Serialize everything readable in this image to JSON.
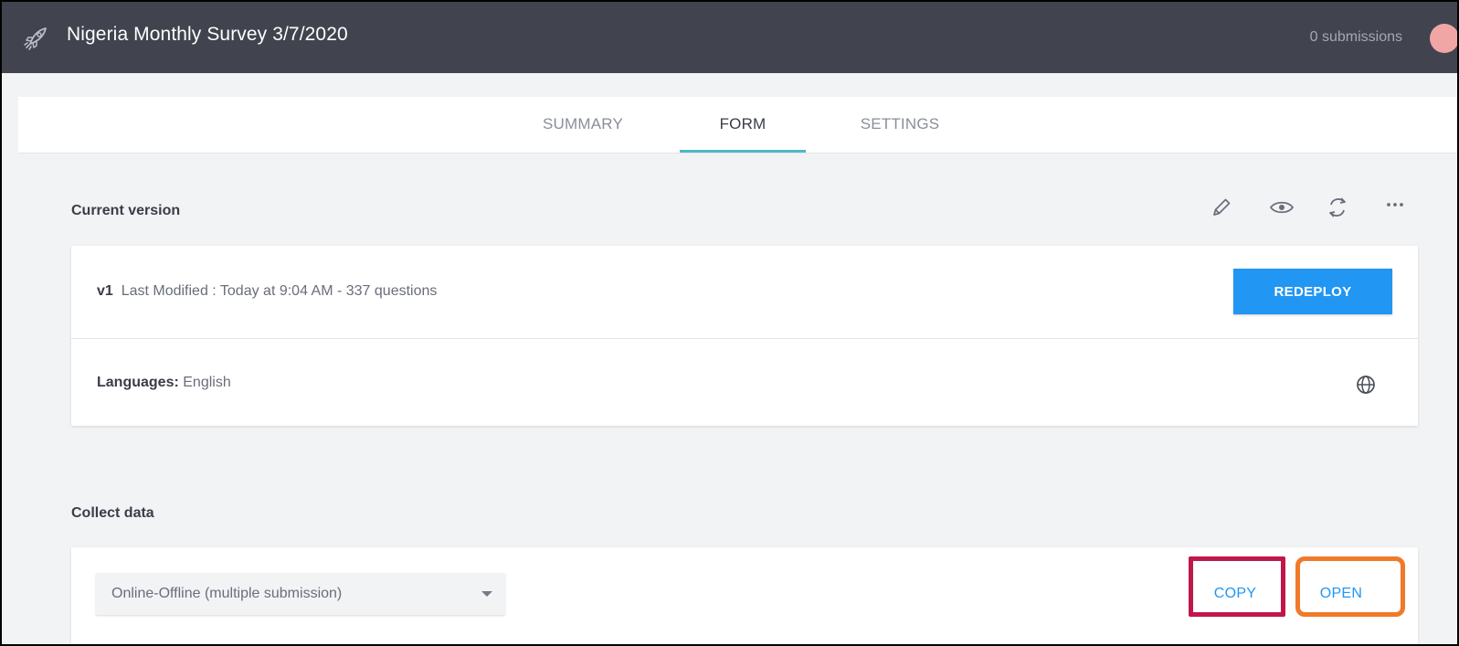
{
  "header": {
    "title": "Nigeria Monthly Survey 3/7/2020",
    "submissions": "0 submissions"
  },
  "tabs": [
    {
      "label": "SUMMARY",
      "active": false
    },
    {
      "label": "FORM",
      "active": true
    },
    {
      "label": "SETTINGS",
      "active": false
    }
  ],
  "current_version": {
    "heading": "Current version",
    "version": "v1",
    "modified": "Last Modified : Today at 9:04 AM - 337 questions",
    "redeploy_label": "REDEPLOY",
    "languages_label": "Languages:",
    "languages_value": "English",
    "toolbar_icons": [
      "pencil-icon",
      "eye-icon",
      "refresh-icon",
      "more-icon"
    ]
  },
  "collect_data": {
    "heading": "Collect data",
    "selected_option": "Online-Offline (multiple submission)",
    "copy_label": "COPY",
    "open_label": "OPEN"
  },
  "colors": {
    "header_bg": "#41444f",
    "accent_blue": "#2196f3",
    "tab_underline": "#4fb8c8",
    "highlight_copy": "#c0174a",
    "highlight_open": "#f07a2a"
  }
}
